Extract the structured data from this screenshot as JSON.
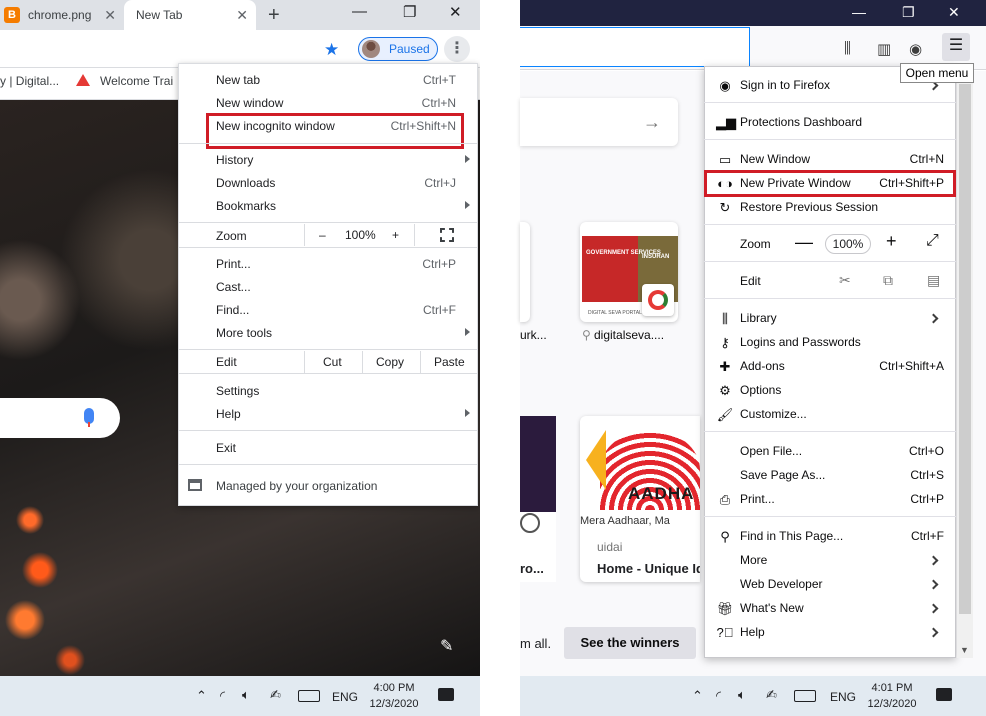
{
  "chrome": {
    "tabs": [
      {
        "label": "chrome.png",
        "icon": "blogger-icon"
      },
      {
        "label": "New Tab",
        "icon": ""
      }
    ],
    "paused_label": "Paused",
    "bookmarks": [
      "y | Digital...",
      "Welcome Trai"
    ],
    "menu": {
      "new_tab": {
        "label": "New tab",
        "shortcut": "Ctrl+T"
      },
      "new_window": {
        "label": "New window",
        "shortcut": "Ctrl+N"
      },
      "new_incognito": {
        "label": "New incognito window",
        "shortcut": "Ctrl+Shift+N"
      },
      "history": "History",
      "downloads": {
        "label": "Downloads",
        "shortcut": "Ctrl+J"
      },
      "bookmarks": "Bookmarks",
      "zoom": {
        "label": "Zoom",
        "minus": "–",
        "value": "100%",
        "plus": "+"
      },
      "print": {
        "label": "Print...",
        "shortcut": "Ctrl+P"
      },
      "cast": "Cast...",
      "find": {
        "label": "Find...",
        "shortcut": "Ctrl+F"
      },
      "more_tools": "More tools",
      "edit": {
        "label": "Edit",
        "cut": "Cut",
        "copy": "Copy",
        "paste": "Paste"
      },
      "settings": "Settings",
      "help": "Help",
      "exit": "Exit",
      "managed": "Managed by your organization"
    },
    "taskbar": {
      "lang": "ENG",
      "time": "4:00 PM",
      "date": "12/3/2020"
    }
  },
  "firefox": {
    "tooltip": "Open menu",
    "tiles": [
      {
        "label": "urk..."
      },
      {
        "label": "digitalseva....",
        "caption_top": "GOVERNMENT SERVICES",
        "caption_right": "INSURAN",
        "footer": "DIGITAL SEVA PORTAL"
      }
    ],
    "card": {
      "title_img": "AADHA",
      "subtitle": "Mera Aadhaar, Ma",
      "source": "uidai",
      "headline": "Home - Unique Id"
    },
    "card_left_text": "ro...",
    "promo_text": "m all.",
    "winners_button": "See the winners",
    "menu": {
      "sign_in": "Sign in to Firefox",
      "protections": "Protections Dashboard",
      "new_window": {
        "label": "New Window",
        "shortcut": "Ctrl+N"
      },
      "new_private": {
        "label": "New Private Window",
        "shortcut": "Ctrl+Shift+P"
      },
      "restore": "Restore Previous Session",
      "zoom": {
        "label": "Zoom",
        "minus": "—",
        "value": "100%",
        "plus": "+"
      },
      "edit": "Edit",
      "library": "Library",
      "logins": "Logins and Passwords",
      "addons": {
        "label": "Add-ons",
        "shortcut": "Ctrl+Shift+A"
      },
      "options": "Options",
      "customize": "Customize...",
      "open_file": {
        "label": "Open File...",
        "shortcut": "Ctrl+O"
      },
      "save_page": {
        "label": "Save Page As...",
        "shortcut": "Ctrl+S"
      },
      "print": {
        "label": "Print...",
        "shortcut": "Ctrl+P"
      },
      "find": {
        "label": "Find in This Page...",
        "shortcut": "Ctrl+F"
      },
      "more": "More",
      "web_dev": "Web Developer",
      "whats_new": "What's New",
      "help": "Help"
    },
    "taskbar": {
      "lang": "ENG",
      "time": "4:01 PM",
      "date": "12/3/2020"
    }
  },
  "colors": {
    "highlight": "#d01c26",
    "chrome_accent": "#1a73e8",
    "firefox_title": "#202340"
  }
}
